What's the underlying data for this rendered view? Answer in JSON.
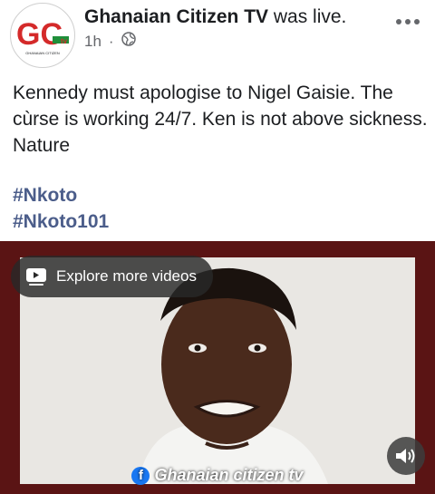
{
  "post": {
    "author": "Ghanaian Citizen TV",
    "action": " was live.",
    "time": "1h",
    "separator": "·",
    "audience_icon": "globe-icon",
    "text": "Kennedy must apologise to Nigel Gaisie. The cùrse is working 24/7. Ken is not above sickness. Nature",
    "hashtags": [
      "#Nkoto",
      "#Nkoto101"
    ]
  },
  "avatar": {
    "logo_text": "GC",
    "logo_sub": "tv",
    "logo_caption": "GHANAIAN CITIZEN"
  },
  "video": {
    "explore_label": "Explore more videos",
    "watermark": "Ghanaian citizen tv",
    "watermark_icon": "facebook-icon",
    "sound_icon": "speaker-icon"
  },
  "colors": {
    "accent_red": "#d42a2a",
    "accent_green": "#1f8f3a",
    "hashtag": "#4b5d8a",
    "video_border": "#5a1414"
  }
}
